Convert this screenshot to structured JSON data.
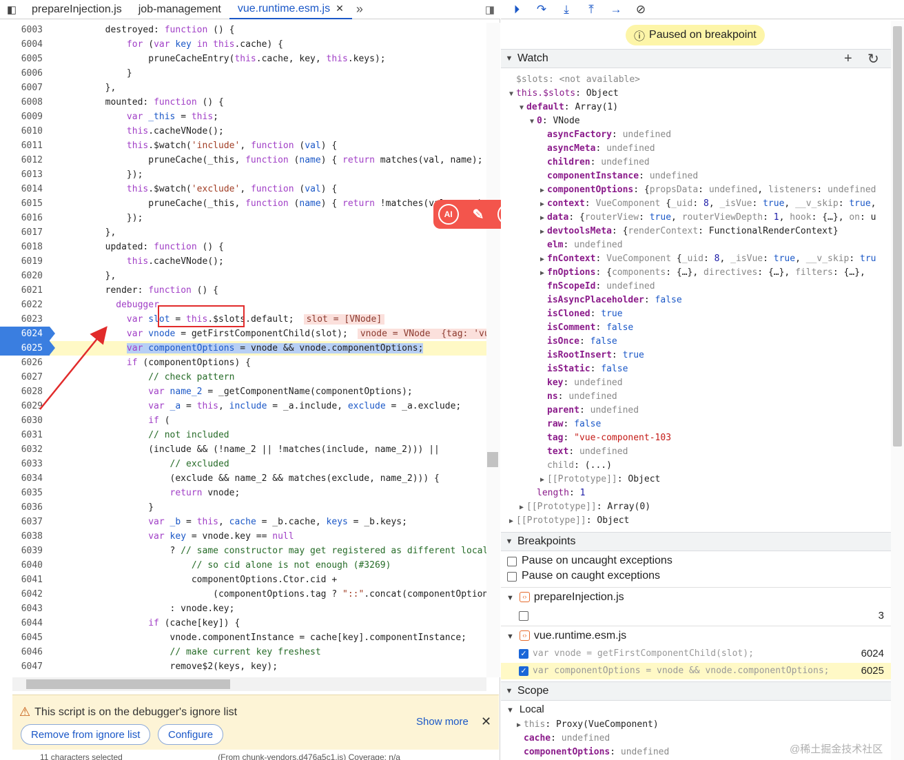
{
  "tabs": [
    "prepareInjection.js",
    "job-management",
    "vue.runtime.esm.js"
  ],
  "code_lines": [
    {
      "n": "6003",
      "h": "        destroyed: <span class=\"k\">function</span> () {"
    },
    {
      "n": "6004",
      "h": "            <span class=\"k\">for</span> (<span class=\"k\">var</span> <span class=\"t\">key</span> <span class=\"k\">in</span> <span class=\"k\">this</span>.cache) {"
    },
    {
      "n": "6005",
      "h": "                pruneCacheEntry(<span class=\"k\">this</span>.cache, key, <span class=\"k\">this</span>.keys);"
    },
    {
      "n": "6006",
      "h": "            }"
    },
    {
      "n": "6007",
      "h": "        },"
    },
    {
      "n": "6008",
      "h": "        mounted: <span class=\"k\">function</span> () {"
    },
    {
      "n": "6009",
      "h": "            <span class=\"k\">var</span> <span class=\"t\">_this</span> = <span class=\"k\">this</span>;"
    },
    {
      "n": "6010",
      "h": "            <span class=\"k\">this</span>.cacheVNode();"
    },
    {
      "n": "6011",
      "h": "            <span class=\"k\">this</span>.$watch(<span class=\"s\">'include'</span>, <span class=\"k\">function</span> (<span class=\"t\">val</span>) {"
    },
    {
      "n": "6012",
      "h": "                pruneCache(_this, <span class=\"k\">function</span> (<span class=\"t\">name</span>) { <span class=\"k\">return</span> matches(val, name); })"
    },
    {
      "n": "6013",
      "h": "            });"
    },
    {
      "n": "6014",
      "h": "            <span class=\"k\">this</span>.$watch(<span class=\"s\">'exclude'</span>, <span class=\"k\">function</span> (<span class=\"t\">val</span>) {"
    },
    {
      "n": "6015",
      "h": "                pruneCache(_this, <span class=\"k\">function</span> (<span class=\"t\">name</span>) { <span class=\"k\">return</span> !matches(val, name); })"
    },
    {
      "n": "6016",
      "h": "            });"
    },
    {
      "n": "6017",
      "h": "        },"
    },
    {
      "n": "6018",
      "h": "        updated: <span class=\"k\">function</span> () {"
    },
    {
      "n": "6019",
      "h": "            <span class=\"k\">this</span>.cacheVNode();"
    },
    {
      "n": "6020",
      "h": "        },"
    },
    {
      "n": "6021",
      "h": "        render: <span class=\"k\">function</span> () {"
    },
    {
      "n": "6022",
      "h": "          <span class=\"k\">debugger</span>"
    },
    {
      "n": "6023",
      "h": "            <span class=\"k\">var</span> <span class=\"t\">slot</span> = <span class=\"k\">this</span>.$slots.default;<span class=\"ival\">slot = [VNode]</span>"
    },
    {
      "n": "6024",
      "h": "            <span class=\"k\">var</span> <span class=\"t\">vnode</span> = getFirstComponentChild(slot);<span class=\"ival\">vnode = VNode  {tag: 'vue-</span>",
      "bp": true
    },
    {
      "n": "6025",
      "h": "            <span class=\"sel\"><span class=\"k\">var</span> <span class=\"t\">componentOptions</span> = vnode &amp;&amp; vnode.componentOptions;</span>",
      "bp": true,
      "exec": true
    },
    {
      "n": "6026",
      "h": "            <span class=\"k\">if</span> (componentOptions) {"
    },
    {
      "n": "6027",
      "h": "                <span class=\"c\">// check pattern</span>"
    },
    {
      "n": "6028",
      "h": "                <span class=\"k\">var</span> <span class=\"t\">name_2</span> = _getComponentName(componentOptions);"
    },
    {
      "n": "6029",
      "h": "                <span class=\"k\">var</span> <span class=\"t\">_a</span> = <span class=\"k\">this</span>, <span class=\"t\">include</span> = _a.include, <span class=\"t\">exclude</span> = _a.exclude;"
    },
    {
      "n": "6030",
      "h": "                <span class=\"k\">if</span> ("
    },
    {
      "n": "6031",
      "h": "                <span class=\"c\">// not included</span>"
    },
    {
      "n": "6032",
      "h": "                (include &amp;&amp; (!name_2 || !matches(include, name_2))) ||"
    },
    {
      "n": "6033",
      "h": "                    <span class=\"c\">// excluded</span>"
    },
    {
      "n": "6034",
      "h": "                    (exclude &amp;&amp; name_2 &amp;&amp; matches(exclude, name_2))) {"
    },
    {
      "n": "6035",
      "h": "                    <span class=\"k\">return</span> vnode;"
    },
    {
      "n": "6036",
      "h": "                }"
    },
    {
      "n": "6037",
      "h": "                <span class=\"k\">var</span> <span class=\"t\">_b</span> = <span class=\"k\">this</span>, <span class=\"t\">cache</span> = _b.cache, <span class=\"t\">keys</span> = _b.keys;"
    },
    {
      "n": "6038",
      "h": "                <span class=\"k\">var</span> <span class=\"t\">key</span> = vnode.key == <span class=\"k\">null</span>"
    },
    {
      "n": "6039",
      "h": "                    ? <span class=\"c\">// same constructor may get registered as different local c</span>"
    },
    {
      "n": "6040",
      "h": "                        <span class=\"c\">// so cid alone is not enough (#3269)</span>"
    },
    {
      "n": "6041",
      "h": "                        componentOptions.Ctor.cid +"
    },
    {
      "n": "6042",
      "h": "                            (componentOptions.tag ? <span class=\"s\">\"::\"</span>.concat(componentOptions."
    },
    {
      "n": "6043",
      "h": "                    : vnode.key;"
    },
    {
      "n": "6044",
      "h": "                <span class=\"k\">if</span> (cache[key]) {"
    },
    {
      "n": "6045",
      "h": "                    vnode.componentInstance = cache[key].componentInstance;"
    },
    {
      "n": "6046",
      "h": "                    <span class=\"c\">// make current key freshest</span>"
    },
    {
      "n": "6047",
      "h": "                    remove$2(keys, key);"
    }
  ],
  "ignore_banner": {
    "message": "This script is on the debugger's ignore list",
    "remove_label": "Remove from ignore list",
    "configure_label": "Configure",
    "show_more": "Show more"
  },
  "status_bar": {
    "selection": "11 characters selected",
    "source": "(From chunk-vendors.d476a5c1.js) Coverage: n/a"
  },
  "paused_label": "Paused on breakpoint",
  "sections": {
    "watch": "Watch",
    "breakpoints": "Breakpoints",
    "scope": "Scope",
    "local": "Local"
  },
  "watch_lines": [
    {
      "i": 0,
      "a": "",
      "h": "<span class=\"gv\">$slots: &lt;not available&gt;</span>"
    },
    {
      "i": 0,
      "a": "down",
      "h": "<span class=\"pn plain\">this.$slots</span>: Object"
    },
    {
      "i": 1,
      "a": "down",
      "h": "<span class=\"pn\">default</span>: Array(1)"
    },
    {
      "i": 2,
      "a": "down",
      "h": "<span class=\"pn\">0</span>: VNode"
    },
    {
      "i": 3,
      "a": "",
      "h": "<span class=\"pn\">asyncFactory</span>: <span class=\"gv\">undefined</span>"
    },
    {
      "i": 3,
      "a": "",
      "h": "<span class=\"pn\">asyncMeta</span>: <span class=\"gv\">undefined</span>"
    },
    {
      "i": 3,
      "a": "",
      "h": "<span class=\"pn\">children</span>: <span class=\"gv\">undefined</span>"
    },
    {
      "i": 3,
      "a": "",
      "h": "<span class=\"pn\">componentInstance</span>: <span class=\"gv\">undefined</span>"
    },
    {
      "i": 3,
      "a": "right",
      "h": "<span class=\"pn\">componentOptions</span>: {<span class=\"gv\">propsData</span>: <span class=\"gv\">undefined</span>, <span class=\"gv\">listeners</span>: <span class=\"gv\">undefined</span>"
    },
    {
      "i": 3,
      "a": "right",
      "h": "<span class=\"pn\">context</span>: <span class=\"gv\">VueComponent</span> {<span class=\"gv\">_uid</span>: <span class=\"nv\">8</span>, <span class=\"gv\">_isVue</span>: <span class=\"bv\">true</span>, <span class=\"gv\">__v_skip</span>: <span class=\"bv\">true</span>,"
    },
    {
      "i": 3,
      "a": "right",
      "h": "<span class=\"pn\">data</span>: {<span class=\"gv\">routerView</span>: <span class=\"bv\">true</span>, <span class=\"gv\">routerViewDepth</span>: <span class=\"nv\">1</span>, <span class=\"gv\">hook</span>: {…}, <span class=\"gv\">on</span>: u"
    },
    {
      "i": 3,
      "a": "right",
      "h": "<span class=\"pn\">devtoolsMeta</span>: {<span class=\"gv\">renderContext</span>: FunctionalRenderContext}"
    },
    {
      "i": 3,
      "a": "",
      "h": "<span class=\"pn\">elm</span>: <span class=\"gv\">undefined</span>"
    },
    {
      "i": 3,
      "a": "right",
      "h": "<span class=\"pn\">fnContext</span>: <span class=\"gv\">VueComponent</span> {<span class=\"gv\">_uid</span>: <span class=\"nv\">8</span>, <span class=\"gv\">_isVue</span>: <span class=\"bv\">true</span>, <span class=\"gv\">__v_skip</span>: <span class=\"bv\">tru</span>"
    },
    {
      "i": 3,
      "a": "right",
      "h": "<span class=\"pn\">fnOptions</span>: {<span class=\"gv\">components</span>: {…}, <span class=\"gv\">directives</span>: {…}, <span class=\"gv\">filters</span>: {…},"
    },
    {
      "i": 3,
      "a": "",
      "h": "<span class=\"pn\">fnScopeId</span>: <span class=\"gv\">undefined</span>"
    },
    {
      "i": 3,
      "a": "",
      "h": "<span class=\"pn\">isAsyncPlaceholder</span>: <span class=\"bv\">false</span>"
    },
    {
      "i": 3,
      "a": "",
      "h": "<span class=\"pn\">isCloned</span>: <span class=\"bv\">true</span>"
    },
    {
      "i": 3,
      "a": "",
      "h": "<span class=\"pn\">isComment</span>: <span class=\"bv\">false</span>"
    },
    {
      "i": 3,
      "a": "",
      "h": "<span class=\"pn\">isOnce</span>: <span class=\"bv\">false</span>"
    },
    {
      "i": 3,
      "a": "",
      "h": "<span class=\"pn\">isRootInsert</span>: <span class=\"bv\">true</span>"
    },
    {
      "i": 3,
      "a": "",
      "h": "<span class=\"pn\">isStatic</span>: <span class=\"bv\">false</span>"
    },
    {
      "i": 3,
      "a": "",
      "h": "<span class=\"pn\">key</span>: <span class=\"gv\">undefined</span>"
    },
    {
      "i": 3,
      "a": "",
      "h": "<span class=\"pn\">ns</span>: <span class=\"gv\">undefined</span>"
    },
    {
      "i": 3,
      "a": "",
      "h": "<span class=\"pn\">parent</span>: <span class=\"gv\">undefined</span>"
    },
    {
      "i": 3,
      "a": "",
      "h": "<span class=\"pn\">raw</span>: <span class=\"bv\">false</span>"
    },
    {
      "i": 3,
      "a": "",
      "h": "<span class=\"pn\">tag</span>: <span class=\"sv\">\"vue-component-103</span>"
    },
    {
      "i": 3,
      "a": "",
      "h": "<span class=\"pn\">text</span>: <span class=\"gv\">undefined</span>"
    },
    {
      "i": 3,
      "a": "",
      "h": "<span class=\"gv\">child</span>: (...)"
    },
    {
      "i": 3,
      "a": "right",
      "h": "<span class=\"gv\">[[Prototype]]</span>: Object"
    },
    {
      "i": 2,
      "a": "",
      "h": "<span class=\"pn plain\">length</span>: <span class=\"nv\">1</span>"
    },
    {
      "i": 1,
      "a": "right",
      "h": "<span class=\"gv\">[[Prototype]]</span>: Array(0)"
    },
    {
      "i": 0,
      "a": "right",
      "h": "<span class=\"gv\">[[Prototype]]</span>: Object"
    }
  ],
  "breakpoints": {
    "uncaught": "Pause on uncaught exceptions",
    "caught": "Pause on caught exceptions",
    "file1": "prepareInjection.js",
    "file1_line": "3",
    "file2": "vue.runtime.esm.js",
    "bp1_code": "var vnode = getFirstComponentChild(slot);",
    "bp1_line": "6024",
    "bp2_code": "var componentOptions = vnode && vnode.componentOptions;",
    "bp2_line": "6025"
  },
  "scope_lines": [
    {
      "i": 1,
      "a": "right",
      "h": "<span class=\"gv\">this</span>: Proxy(VueComponent)"
    },
    {
      "i": 1,
      "a": "",
      "h": "<span class=\"pn\">cache</span>: <span class=\"gv\">undefined</span>"
    },
    {
      "i": 1,
      "a": "",
      "h": "<span class=\"pn\">componentOptions</span>: <span class=\"gv\">undefined</span>"
    }
  ],
  "watermark": "@稀土掘金技术社区",
  "floatbar_ai": "AI"
}
